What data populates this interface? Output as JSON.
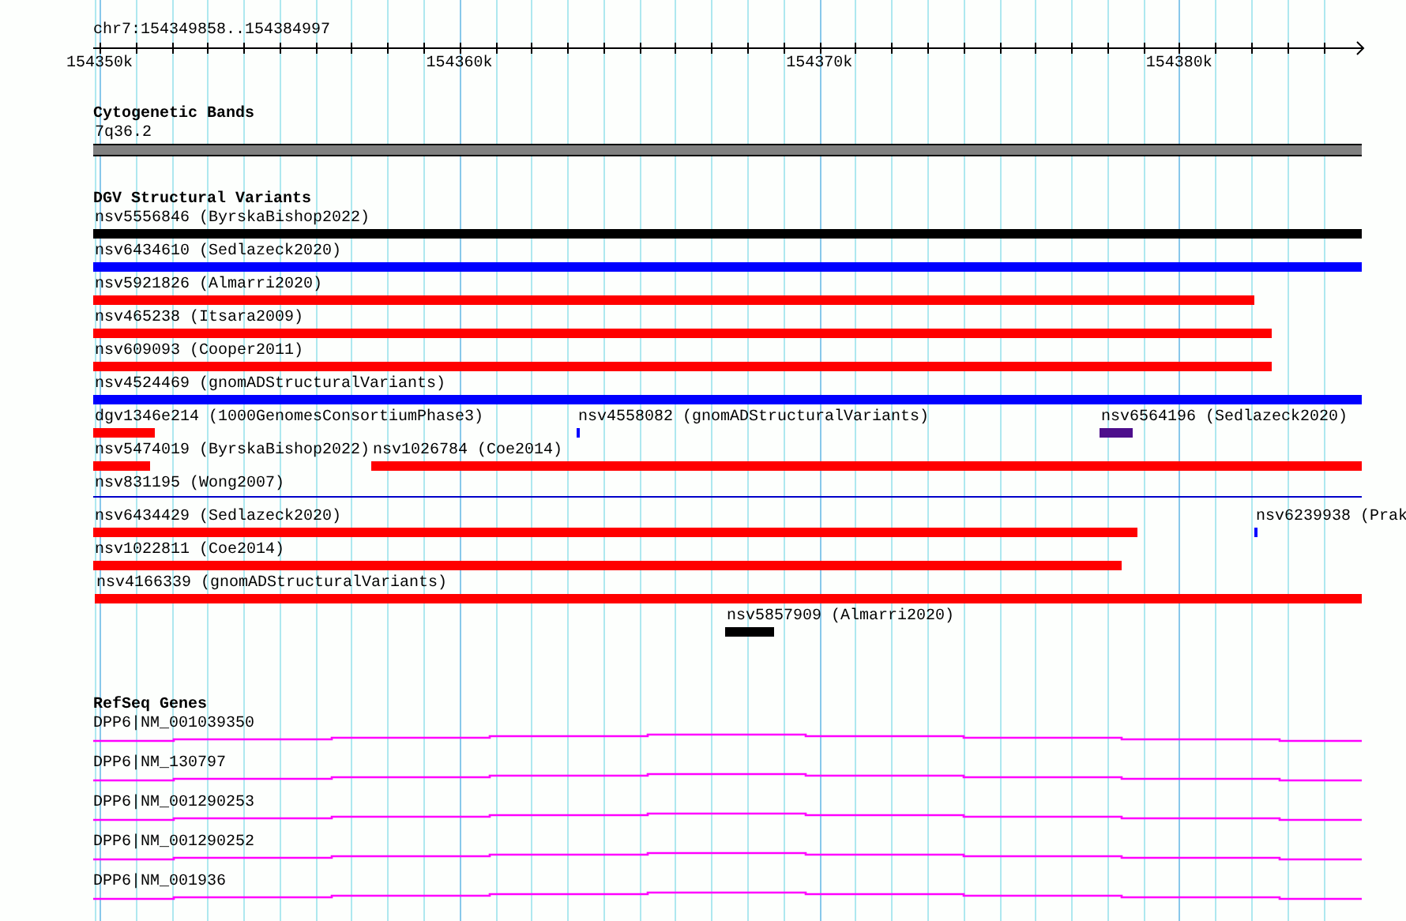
{
  "ruler": {
    "location": "chr7:154349858..154384997",
    "ticks": [
      "154350k",
      "154360k",
      "154370k",
      "154380k"
    ]
  },
  "tracks": [
    {
      "title": "Cytogenetic Bands",
      "kind": "bands",
      "rows": [
        {
          "features": [
            {
              "label": "7q36.2",
              "color": "#808080"
            }
          ]
        }
      ]
    },
    {
      "title": "DGV Structural Variants",
      "kind": "variants",
      "rows": [
        {
          "features": [
            {
              "label": "nsv5556846 (ByrskaBishop2022)",
              "kind": "bar",
              "color": "#000000"
            }
          ]
        },
        {
          "features": [
            {
              "label": "nsv6434610 (Sedlazeck2020)",
              "kind": "bar",
              "color": "#0000ff"
            }
          ]
        },
        {
          "features": [
            {
              "label": "nsv5921826 (Almarri2020)",
              "kind": "bar",
              "color": "#ff0000"
            }
          ]
        },
        {
          "features": [
            {
              "label": "nsv465238 (Itsara2009)",
              "kind": "bar",
              "color": "#ff0000"
            }
          ]
        },
        {
          "features": [
            {
              "label": "nsv609093 (Cooper2011)",
              "kind": "bar",
              "color": "#ff0000"
            }
          ]
        },
        {
          "features": [
            {
              "label": "nsv4524469 (gnomADStructuralVariants)",
              "kind": "bar",
              "color": "#0000ff"
            }
          ]
        },
        {
          "features": [
            {
              "label": "dgv1346e214 (1000GenomesConsortiumPhase3)",
              "kind": "bar",
              "color": "#ff0000"
            },
            {
              "label": "nsv4558082 (gnomADStructuralVariants)",
              "kind": "bar",
              "color": "#0000ff"
            },
            {
              "label": "nsv6564196 (Sedlazeck2020)",
              "kind": "bar",
              "color": "#4d0f8c"
            }
          ]
        },
        {
          "features": [
            {
              "label": "nsv5474019 (ByrskaBishop2022)",
              "kind": "bar",
              "color": "#ff0000"
            },
            {
              "label": "nsv1026784 (Coe2014)",
              "kind": "bar",
              "color": "#ff0000"
            }
          ]
        },
        {
          "features": [
            {
              "label": "nsv831195 (Wong2007)",
              "kind": "line",
              "color": "#0000c8"
            }
          ]
        },
        {
          "features": [
            {
              "label": "nsv6434429 (Sedlazeck2020)",
              "kind": "bar",
              "color": "#ff0000"
            },
            {
              "label": "nsv6239938 (Prak",
              "kind": "bar",
              "color": "#0000ff"
            }
          ]
        },
        {
          "features": [
            {
              "label": "nsv1022811 (Coe2014)",
              "kind": "bar",
              "color": "#ff0000"
            }
          ]
        },
        {
          "features": [
            {
              "label": "nsv4166339 (gnomADStructuralVariants)",
              "kind": "bar",
              "color": "#ff0000"
            }
          ]
        },
        {
          "features": [
            {
              "label": "nsv5857909 (Almarri2020)",
              "kind": "bar",
              "color": "#000000"
            }
          ]
        }
      ]
    },
    {
      "title": "RefSeq Genes",
      "kind": "genes",
      "rows": [
        {
          "features": [
            {
              "label": "DPP6|NM_001039350",
              "color": "#ff00ff"
            }
          ]
        },
        {
          "features": [
            {
              "label": "DPP6|NM_130797",
              "color": "#ff00ff"
            }
          ]
        },
        {
          "features": [
            {
              "label": "DPP6|NM_001290253",
              "color": "#ff00ff"
            }
          ]
        },
        {
          "features": [
            {
              "label": "DPP6|NM_001290252",
              "color": "#ff00ff"
            }
          ]
        },
        {
          "features": [
            {
              "label": "DPP6|NM_001936",
              "color": "#ff00ff"
            }
          ]
        }
      ]
    }
  ]
}
